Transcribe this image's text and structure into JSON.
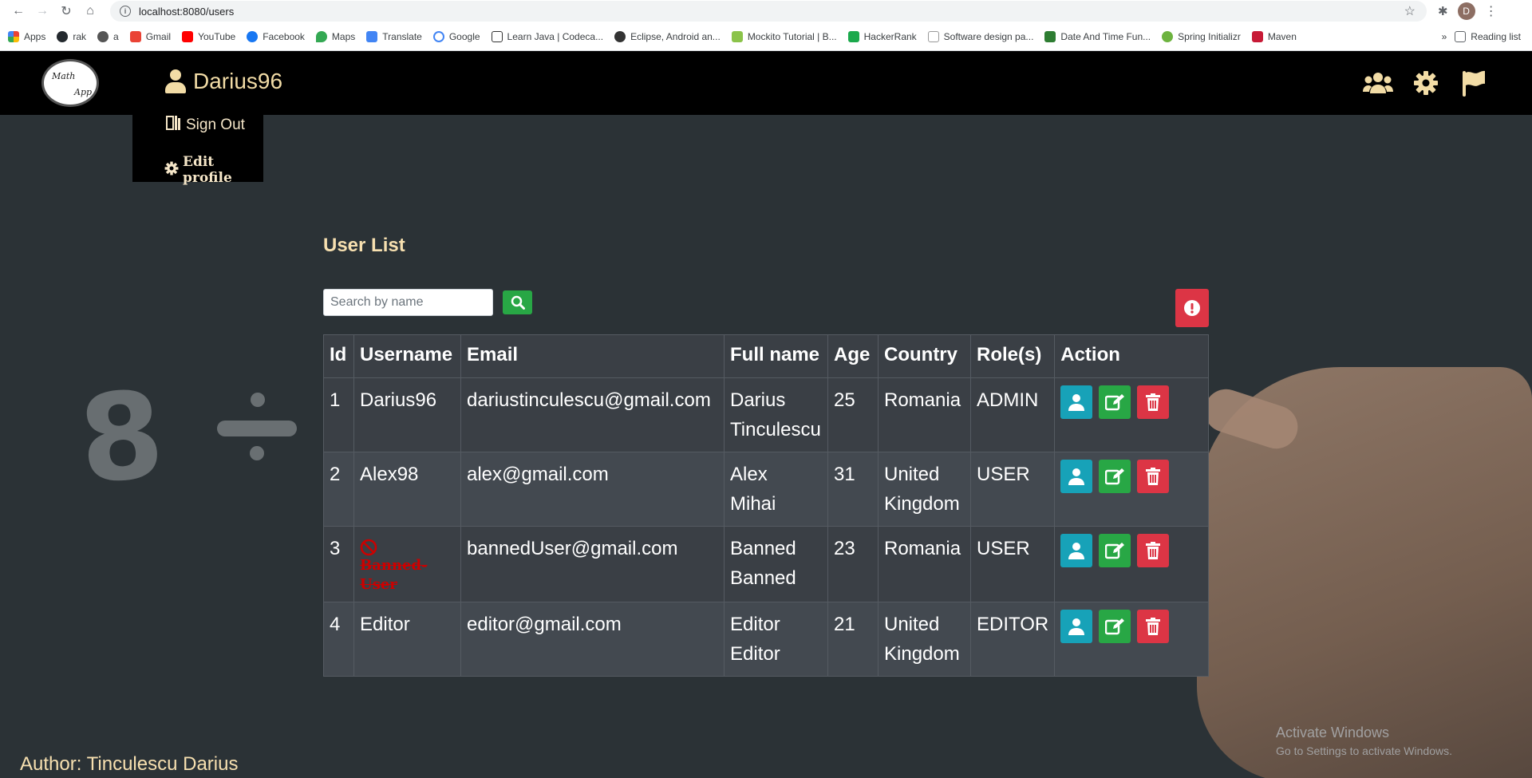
{
  "browser": {
    "url": "localhost:8080/users",
    "profile_initial": "D",
    "bookmarks": [
      "Apps",
      "rak",
      "a",
      "Gmail",
      "YouTube",
      "Facebook",
      "Maps",
      "Translate",
      "Google",
      "Learn Java | Codeca...",
      "Eclipse, Android an...",
      "Mockito Tutorial | B...",
      "HackerRank",
      "Software design pa...",
      "Date And Time Fun...",
      "Spring Initializr",
      "Maven"
    ],
    "more": "»",
    "reading_list": "Reading list"
  },
  "header": {
    "logo_line1": "Math",
    "logo_line2": "App",
    "username": "Darius96",
    "icons": [
      "users-icon",
      "gear-icon",
      "flag-icon"
    ]
  },
  "dropdown": {
    "sign_out": "Sign Out",
    "edit_profile": "Edit profile"
  },
  "main": {
    "title": "User List",
    "search_placeholder": "Search by name",
    "columns": [
      "Id",
      "Username",
      "Email",
      "Full name",
      "Age",
      "Country",
      "Role(s)",
      "Action"
    ],
    "rows": [
      {
        "id": "1",
        "username": "Darius96",
        "email": "dariustinculescu@gmail.com",
        "name1": "Darius",
        "name2": "Tinculescu",
        "age": "25",
        "country1": "Romania",
        "country2": "",
        "role": "ADMIN",
        "banned": false
      },
      {
        "id": "2",
        "username": "Alex98",
        "email": "alex@gmail.com",
        "name1": "Alex",
        "name2": "Mihai",
        "age": "31",
        "country1": "United",
        "country2": "Kingdom",
        "role": "USER",
        "banned": false
      },
      {
        "id": "3",
        "username": "Banned-User",
        "username_line1": "Banned-",
        "username_line2": "User",
        "email": "bannedUser@gmail.com",
        "name1": "Banned",
        "name2": "Banned",
        "age": "23",
        "country1": "Romania",
        "country2": "",
        "role": "USER",
        "banned": true
      },
      {
        "id": "4",
        "username": "Editor",
        "email": "editor@gmail.com",
        "name1": "Editor",
        "name2": "Editor",
        "age": "21",
        "country1": "United",
        "country2": "Kingdom",
        "role": "EDITOR",
        "banned": false
      }
    ]
  },
  "footer": {
    "author": "Author: Tinculescu Darius"
  },
  "watermark": {
    "line1": "Activate Windows",
    "line2": "Go to Settings to activate Windows."
  },
  "colors": {
    "accent_text": "#f7e0b0",
    "view": "#17a2b8",
    "edit": "#28a745",
    "delete": "#dc3545"
  }
}
